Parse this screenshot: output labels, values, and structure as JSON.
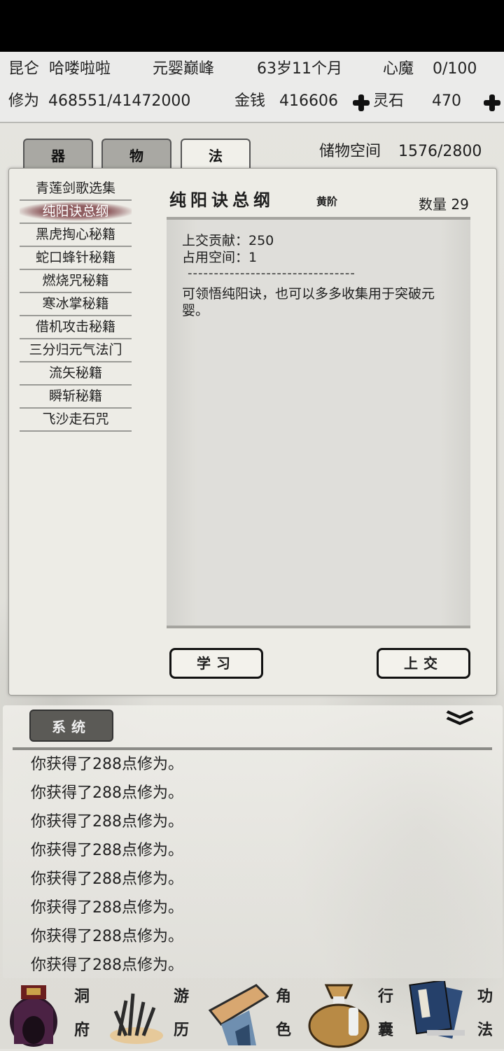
{
  "header": {
    "sect": "昆仑",
    "player_name": "哈喽啦啦",
    "realm": "元婴巅峰",
    "age": "63岁11个月",
    "xinmo_label": "心魔",
    "xinmo_value": "0/100",
    "xiuwei_label": "修为",
    "xiuwei_value": "468551/41472000",
    "money_label": "金钱",
    "money_value": "416606",
    "lingshi_label": "灵石",
    "lingshi_value": "470"
  },
  "tabs": [
    {
      "label": "器",
      "active": false
    },
    {
      "label": "物",
      "active": false
    },
    {
      "label": "法",
      "active": true
    }
  ],
  "storage": {
    "label": "储物空间",
    "value": "1576/2800"
  },
  "items": [
    {
      "label": "青莲剑歌选集"
    },
    {
      "label": "纯阳诀总纲",
      "selected": true
    },
    {
      "label": "黑虎掏心秘籍"
    },
    {
      "label": "蛇口蜂针秘籍"
    },
    {
      "label": "燃烧咒秘籍"
    },
    {
      "label": "寒冰掌秘籍"
    },
    {
      "label": "借机攻击秘籍"
    },
    {
      "label": "三分归元气法门"
    },
    {
      "label": "流矢秘籍"
    },
    {
      "label": "瞬斩秘籍"
    },
    {
      "label": "飞沙走石咒"
    }
  ],
  "detail": {
    "name": "纯阳诀总纲",
    "grade": "黄阶",
    "quantity_label": "数量",
    "quantity": "29",
    "contribution": "上交贡献：250",
    "space": "占用空间：1",
    "divider": "--------------------------------",
    "description": "可领悟纯阳诀，也可以多多收集用于突破元婴。"
  },
  "actions": {
    "learn": "学习",
    "submit": "上交"
  },
  "log": {
    "tab_label": "系统",
    "collapse_icon": "double-chevron-down",
    "lines": [
      "你获得了288点修为。",
      "你获得了288点修为。",
      "你获得了288点修为。",
      "你获得了288点修为。",
      "你获得了288点修为。",
      "你获得了288点修为。",
      "你获得了288点修为。",
      "你获得了288点修为。"
    ]
  },
  "nav": [
    {
      "label": "洞府",
      "icon": "cave-dwelling-icon"
    },
    {
      "label": "游历",
      "icon": "grass-travel-icon"
    },
    {
      "label": "角色",
      "icon": "character-hat-icon"
    },
    {
      "label": "行囊",
      "icon": "bag-icon"
    },
    {
      "label": "功法",
      "icon": "books-icon"
    }
  ],
  "colors": {
    "selected_brush": "#8f5d60",
    "panel": "#edece6",
    "active_tab": "#f1f0ea",
    "inactive_tab": "#a9a8a3"
  }
}
